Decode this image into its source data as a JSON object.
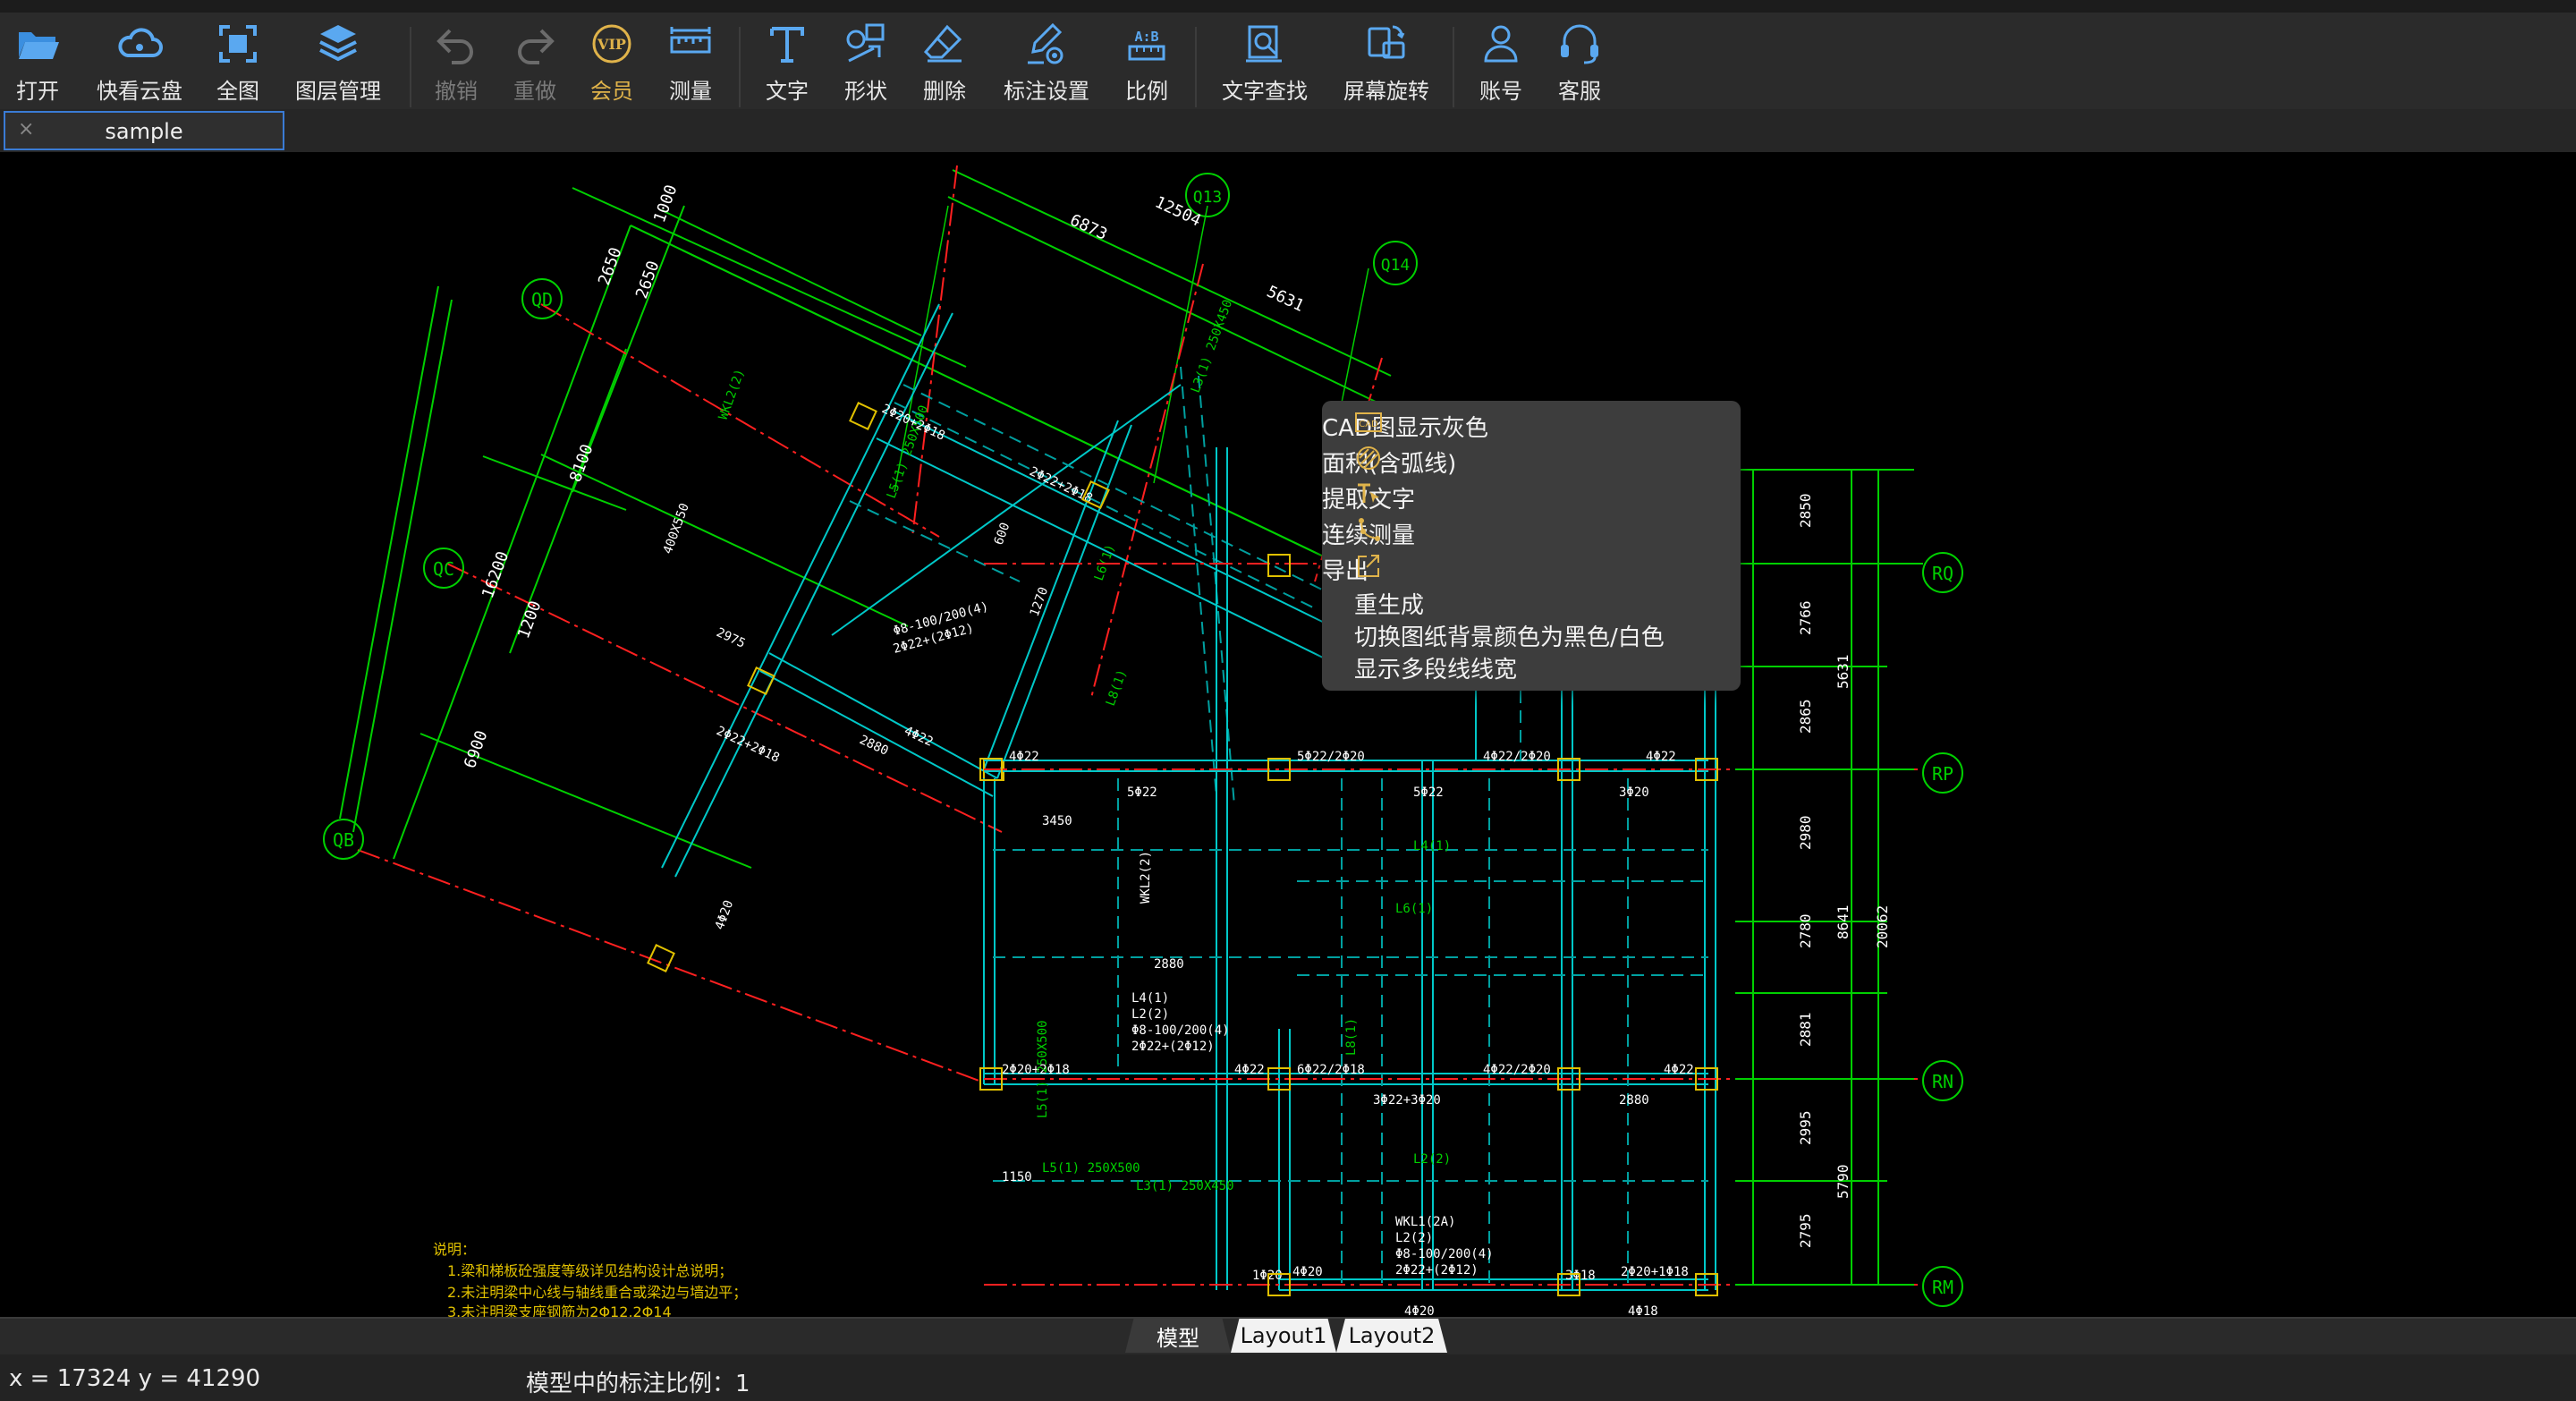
{
  "toolbar": {
    "items": [
      {
        "id": "open",
        "label": "打开",
        "icon": "folder-open-icon"
      },
      {
        "id": "cloud",
        "label": "快看云盘",
        "icon": "cloud-icon"
      },
      {
        "id": "fit",
        "label": "全图",
        "icon": "fit-view-icon"
      },
      {
        "id": "layers",
        "label": "图层管理",
        "icon": "layers-icon"
      },
      {
        "id": "undo",
        "label": "撤销",
        "icon": "undo-icon"
      },
      {
        "id": "redo",
        "label": "重做",
        "icon": "redo-icon"
      },
      {
        "id": "vip",
        "label": "会员",
        "icon": "vip-icon"
      },
      {
        "id": "measure",
        "label": "测量",
        "icon": "ruler-icon"
      },
      {
        "id": "text",
        "label": "文字",
        "icon": "text-tool-icon"
      },
      {
        "id": "shape",
        "label": "形状",
        "icon": "shape-icon"
      },
      {
        "id": "erase",
        "label": "删除",
        "icon": "eraser-icon"
      },
      {
        "id": "dimset",
        "label": "标注设置",
        "icon": "pen-gear-icon"
      },
      {
        "id": "ratio",
        "label": "比例",
        "icon": "ratio-icon"
      },
      {
        "id": "find",
        "label": "文字查找",
        "icon": "text-search-icon"
      },
      {
        "id": "rotate",
        "label": "屏幕旋转",
        "icon": "screen-rotate-icon"
      },
      {
        "id": "account",
        "label": "账号",
        "icon": "user-icon"
      },
      {
        "id": "service",
        "label": "客服",
        "icon": "headset-icon"
      }
    ]
  },
  "tab": {
    "close": "×",
    "title": "sample"
  },
  "context_menu": {
    "items": [
      {
        "label": "CAD图显示灰色",
        "icon": "cad-gray-icon"
      },
      {
        "label": "面积(含弧线)",
        "icon": "area-hatch-icon"
      },
      {
        "label": "提取文字",
        "icon": "extract-text-icon"
      },
      {
        "label": "连续测量",
        "icon": "continuous-measure-icon"
      },
      {
        "label": "导出",
        "icon": "export-icon"
      },
      {
        "label": "重生成"
      },
      {
        "label": "切换图纸背景颜色为黑色/白色"
      },
      {
        "label": "显示多段线线宽"
      }
    ]
  },
  "drawing": {
    "axis_labels": [
      "QD",
      "QC",
      "QB",
      "Q13",
      "Q14",
      "RQ",
      "RP",
      "RN",
      "RM"
    ],
    "dims_top": [
      "6873",
      "12504",
      "5631",
      "1000",
      "2650",
      "2650"
    ],
    "dims_left": [
      "8100",
      "16200",
      "1200",
      "6900"
    ],
    "dims_right": [
      "2850",
      "2766",
      "2865",
      "2980",
      "2780",
      "2881",
      "2995",
      "2795",
      "5631",
      "8641",
      "20062",
      "5790"
    ],
    "notes": [
      "说明：",
      "1.梁和梯板砼强度等级详见结构设计总说明；",
      "2.未注明梁中心线与轴线重合或梁边与墙边平；",
      "3.未注明梁支座钢筋为2Φ12,2Φ14"
    ],
    "labels": [
      "2Φ20+2Φ18",
      "2Φ22+2Φ18",
      "4Φ22",
      "5Φ22",
      "3Φ20",
      "3450",
      "2880",
      "1150",
      "WKL2(2)",
      "400X550",
      "Φ8-100/200(4)",
      "2Φ22+(2Φ12)",
      "L5(1) 250X500",
      "L6(1)",
      "L3(1) 250X450",
      "L8(1)",
      "L4(1)",
      "L2(2)",
      "WKL1(2A)",
      "5Φ22/2Φ20",
      "4Φ22/2Φ20",
      "6Φ22/2Φ18",
      "3Φ22+3Φ20",
      "2Φ20+1Φ18",
      "4Φ18",
      "4Φ20",
      "1Φ20",
      "3Φ18",
      "2975",
      "600",
      "1270"
    ]
  },
  "layout_tabs": [
    "模型",
    "Layout1",
    "Layout2"
  ],
  "status": {
    "coords": "x = 17324 y = 41290",
    "scale": "模型中的标注比例：1"
  },
  "colors": {
    "accent": "#3a7bd5",
    "vip": "#e0b34a",
    "beam": "#00c8c8",
    "dim": "#00d000",
    "axis": "#ff3030",
    "text_white": "#ffffff",
    "column": "#e0c000"
  }
}
